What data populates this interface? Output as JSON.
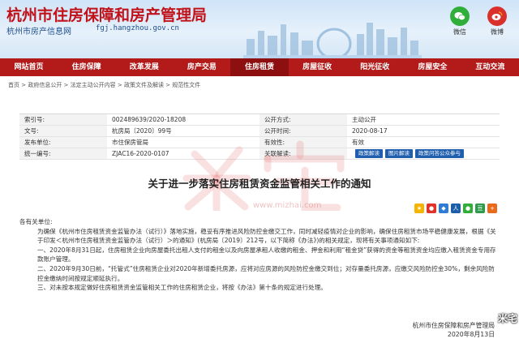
{
  "header": {
    "title": "杭州市住房保障和房产管理局",
    "subtitle": "杭州市房产信息网",
    "url": "fgj.hangzhou.gov.cn",
    "social": [
      {
        "label": "微信",
        "color": "#2fae39"
      },
      {
        "label": "微博",
        "color": "#d9302b"
      }
    ]
  },
  "nav": {
    "items": [
      {
        "label": "网站首页"
      },
      {
        "label": "住房保障"
      },
      {
        "label": "改革发展"
      },
      {
        "label": "房产交易"
      },
      {
        "label": "住房租赁"
      },
      {
        "label": "房屋征收"
      },
      {
        "label": "阳光征收"
      },
      {
        "label": "房屋安全"
      },
      {
        "label": "互动交流"
      }
    ]
  },
  "breadcrumb": "首页 > 政府信息公开 > 法定主动公开内容 > 政策文件及解读 > 规范性文件",
  "info": {
    "rows": [
      {
        "k1": "索引号:",
        "v1": "002489639/2020-18208",
        "k2": "公开方式:",
        "v2": "主动公开"
      },
      {
        "k1": "文号:",
        "v1": "杭房局〔2020〕99号",
        "k2": "公开时间:",
        "v2": "2020-08-17"
      },
      {
        "k1": "发布单位:",
        "v1": "市住保房管局",
        "k2": "有效性:",
        "v2": "有效"
      },
      {
        "k1": "统一编号:",
        "v1": "ZJAC16-2020-0107",
        "k2": "关联解读:"
      }
    ],
    "buttons": [
      "政策解读",
      "图片解读",
      "政策问答公众参与"
    ]
  },
  "doc": {
    "title": "关于进一步落实住房租赁资金监管相关工作的通知",
    "watermark": "www.mizhai.com",
    "paragraphs": [
      "各有关单位:",
      "为确保《杭州市住房租赁资金监管办法（试行）》落地实施，稳妥有序推进风险防控金缴交工作，同时减轻疫情对企业的影响，确保住房租赁市场平稳健康发展，根据《关于印发＜杭州市住房租赁资金监管办法（试行）＞的通知》(杭房局〔2019〕212号，以下简称《办法》)的相关规定，现将有关事项通知如下:",
      "一、2020年8月31日起，住房租赁企业向房屋委托出租人支付的租金以及向房屋承租人收缴的租金、押金和利用“租金贷”获得的资金等租赁资金均应缴入租赁资金专用存款账户管理。",
      "二、2020年9月30日前，“托管式”住房租赁企业对2020年新增委托房源，应将对应房源的风险防控金缴交到位；对存量委托房源，应缴交风险防控金30%，剩余风险防控金缴纳时间按规定顺延执行。",
      "三、对未按本规定做好住房租赁资金监管相关工作的住房租赁企业，将按《办法》第十条的规定进行处理。"
    ],
    "signoff_org": "杭州市住房保障和房产管理局",
    "signoff_date": "2020年8月13日",
    "corner_mark": "米宅"
  },
  "share": [
    {
      "icon": "qzone-icon",
      "color": "#f4b400"
    },
    {
      "icon": "weibo-icon",
      "color": "#e0342a"
    },
    {
      "icon": "tencent-weibo-icon",
      "color": "#2e7cd6"
    },
    {
      "icon": "renren-icon",
      "color": "#1d5ea8"
    },
    {
      "icon": "wechat-icon",
      "color": "#2fae39"
    },
    {
      "icon": "douban-icon",
      "color": "#2f9a4a"
    },
    {
      "icon": "more-icon",
      "color": "#e86a1a"
    }
  ]
}
